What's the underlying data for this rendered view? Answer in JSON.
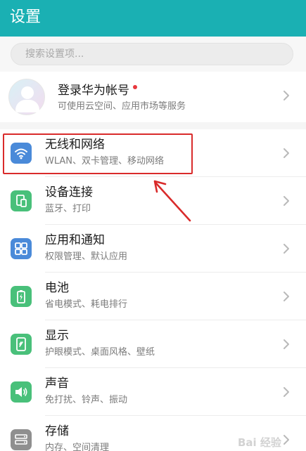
{
  "header": {
    "title": "设置"
  },
  "search": {
    "placeholder": "搜索设置项..."
  },
  "account": {
    "title": "登录华为帐号",
    "subtitle": "可使用云空间、应用市场等服务"
  },
  "settings": [
    {
      "title": "无线和网络",
      "subtitle": "WLAN、双卡管理、移动网络",
      "icon": "wifi-icon",
      "color": "#4a8ad9"
    },
    {
      "title": "设备连接",
      "subtitle": "蓝牙、打印",
      "icon": "device-connection-icon",
      "color": "#49c07a"
    },
    {
      "title": "应用和通知",
      "subtitle": "权限管理、默认应用",
      "icon": "apps-grid-icon",
      "color": "#4a8ad9"
    },
    {
      "title": "电池",
      "subtitle": "省电模式、耗电排行",
      "icon": "battery-icon",
      "color": "#49c07a"
    },
    {
      "title": "显示",
      "subtitle": "护眼模式、桌面风格、壁纸",
      "icon": "display-icon",
      "color": "#49c07a"
    },
    {
      "title": "声音",
      "subtitle": "免打扰、铃声、振动",
      "icon": "sound-icon",
      "color": "#49c07a"
    },
    {
      "title": "存储",
      "subtitle": "内存、空间清理",
      "icon": "storage-icon",
      "color": "#8f8f8f"
    }
  ],
  "annotation": {
    "color": "#d92b2b"
  },
  "watermark": {
    "text": "Bai 经验"
  },
  "colors": {
    "header": "#1ab0b3",
    "text": "#1b1b1b",
    "subtext": "#7b7b7b",
    "badge": "#e8383d"
  }
}
